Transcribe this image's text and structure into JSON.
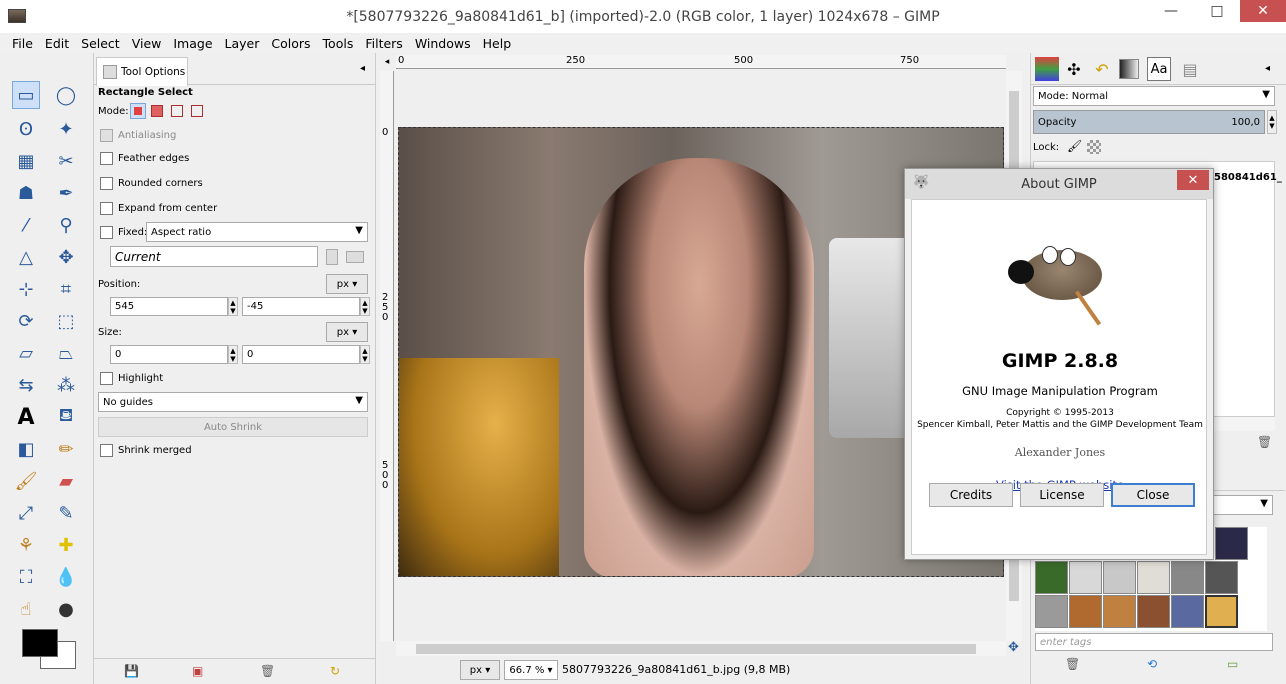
{
  "window": {
    "title": "*[5807793226_9a80841d61_b] (imported)-2.0 (RGB color, 1 layer) 1024x678 – GIMP",
    "minimize": "—",
    "maximize": "□",
    "close": "✕"
  },
  "menu": [
    "File",
    "Edit",
    "Select",
    "View",
    "Image",
    "Layer",
    "Colors",
    "Tools",
    "Filters",
    "Windows",
    "Help"
  ],
  "tool_options": {
    "tab_label": "Tool Options",
    "tool_name": "Rectangle Select",
    "mode_label": "Mode:",
    "antialiasing": "Antialiasing",
    "feather_edges": "Feather edges",
    "rounded_corners": "Rounded corners",
    "expand_from_center": "Expand from center",
    "fixed_label": "Fixed:",
    "fixed_value": "Aspect ratio",
    "current_value": "Current",
    "position_label": "Position:",
    "position_unit": "px",
    "position_x": "545",
    "position_y": "-45",
    "size_label": "Size:",
    "size_unit": "px",
    "size_w": "0",
    "size_h": "0",
    "highlight": "Highlight",
    "guides_value": "No guides",
    "auto_shrink": "Auto Shrink",
    "shrink_merged": "Shrink merged"
  },
  "ruler": {
    "h_ticks": [
      "0",
      "250",
      "500",
      "750"
    ],
    "v_ticks": [
      "0",
      "250",
      "500"
    ]
  },
  "status": {
    "unit": "px",
    "zoom": "66.7 %",
    "file_info": "5807793226_9a80841d61_b.jpg (9,8 MB)"
  },
  "layers": {
    "mode_label": "Mode: Normal",
    "opacity_label": "Opacity",
    "opacity_value": "100,0",
    "lock_label": "Lock:",
    "layer_name": "580841d61_",
    "tags_placeholder": "enter tags"
  },
  "about": {
    "title": "About GIMP",
    "version": "GIMP 2.8.8",
    "subtitle": "GNU Image Manipulation Program",
    "copyright": "Copyright © 1995-2013",
    "authors": "Spencer Kimball, Peter Mattis and the GIMP Development Team",
    "signature": "Alexander Jones",
    "website_link": "Visit the GIMP website",
    "credits_button": "Credits",
    "license_button": "License",
    "close_button": "Close"
  },
  "colors": {
    "accent": "#3c7fd1",
    "close_red": "#c75050"
  }
}
